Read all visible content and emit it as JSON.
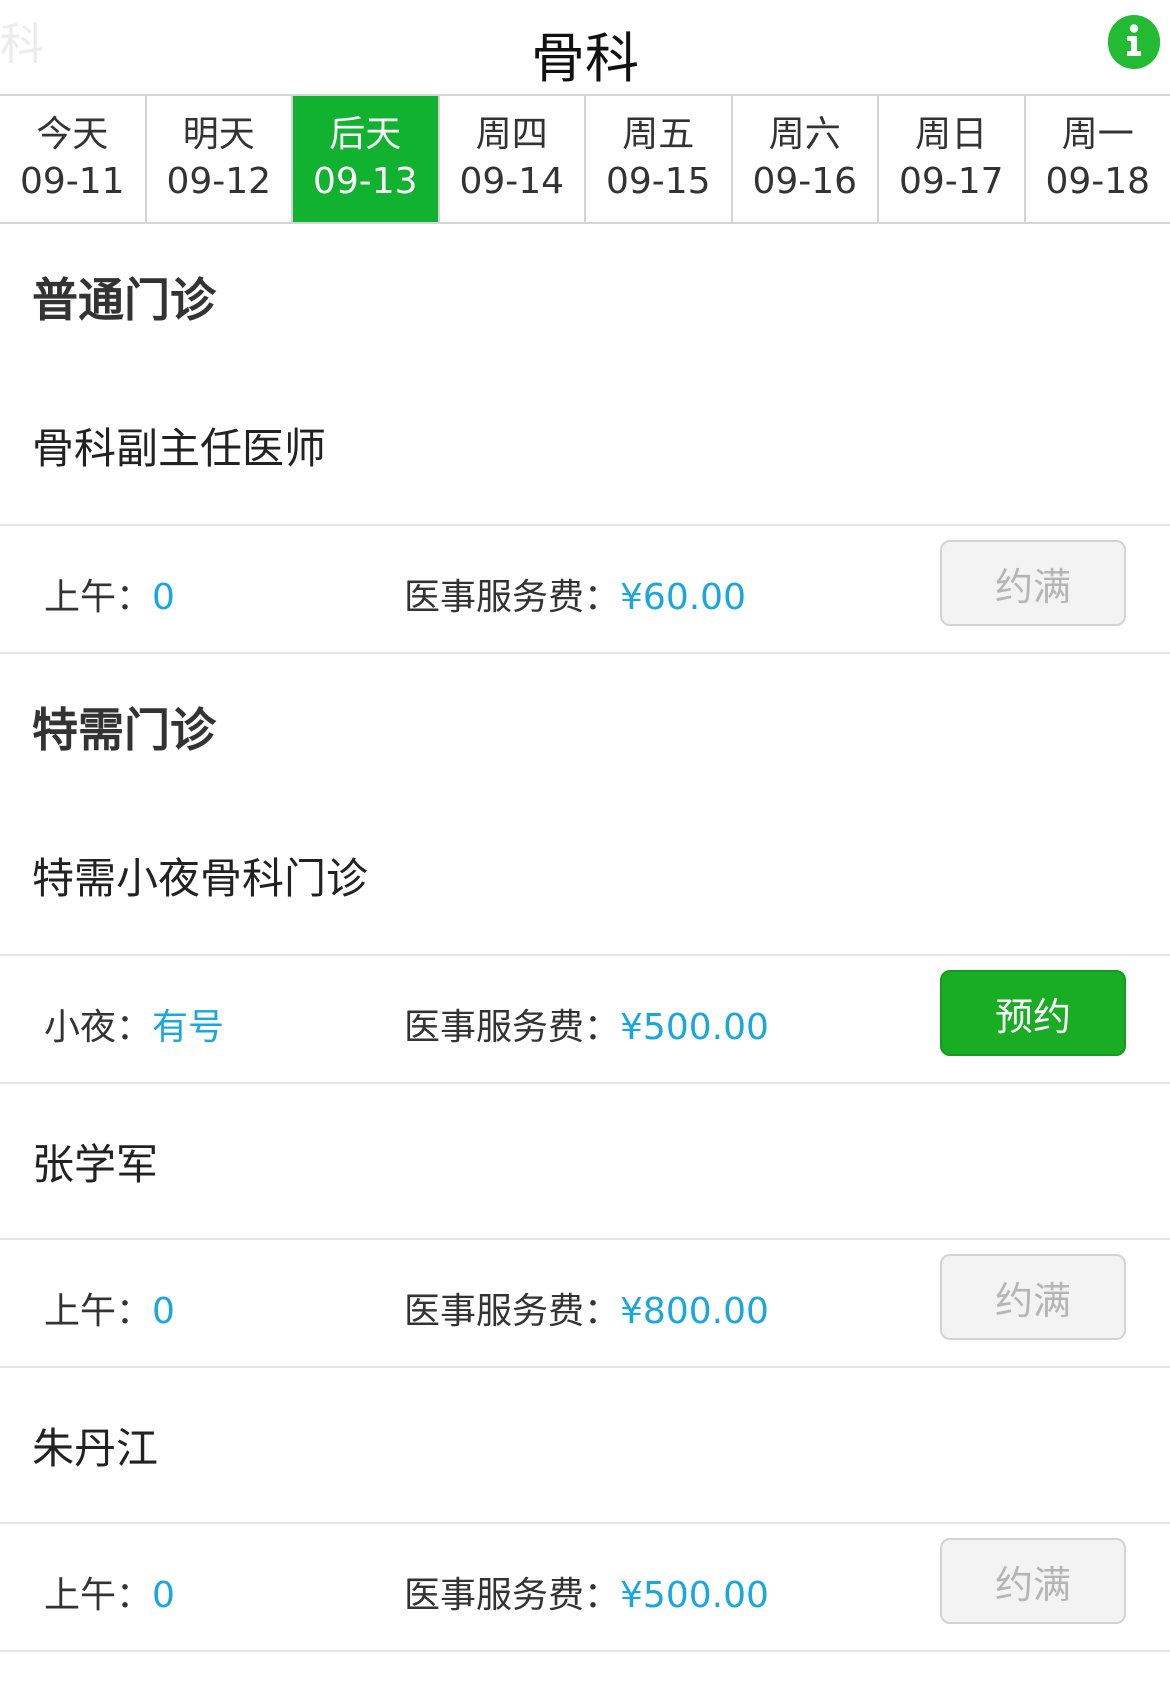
{
  "header": {
    "ghost_text": "科",
    "title": "骨科",
    "info_icon": "info-circle-icon",
    "accent_color": "#22bb33"
  },
  "date_tabs": [
    {
      "day": "今天",
      "date": "09-11",
      "selected": false
    },
    {
      "day": "明天",
      "date": "09-12",
      "selected": false
    },
    {
      "day": "后天",
      "date": "09-13",
      "selected": true
    },
    {
      "day": "周四",
      "date": "09-14",
      "selected": false
    },
    {
      "day": "周五",
      "date": "09-15",
      "selected": false
    },
    {
      "day": "周六",
      "date": "09-16",
      "selected": false
    },
    {
      "day": "周日",
      "date": "09-17",
      "selected": false
    },
    {
      "day": "周一",
      "date": "09-18",
      "selected": false
    }
  ],
  "sections": [
    {
      "title": "普通门诊",
      "doctors": [
        {
          "name": "骨科副主任医师",
          "slot_label": "上午：",
          "slot_value": "0",
          "fee_label": "医事服务费：",
          "fee_value": "¥60.00",
          "button": "约满",
          "status": "full"
        }
      ]
    },
    {
      "title": "特需门诊",
      "doctors": [
        {
          "name": "特需小夜骨科门诊",
          "slot_label": "小夜：",
          "slot_value": "有号",
          "fee_label": "医事服务费：",
          "fee_value": "¥500.00",
          "button": "预约",
          "status": "open"
        },
        {
          "name": "张学军",
          "slot_label": "上午：",
          "slot_value": "0",
          "fee_label": "医事服务费：",
          "fee_value": "¥800.00",
          "button": "约满",
          "status": "full"
        },
        {
          "name": "朱丹江",
          "slot_label": "上午：",
          "slot_value": "0",
          "fee_label": "医事服务费：",
          "fee_value": "¥500.00",
          "button": "约满",
          "status": "full"
        }
      ]
    }
  ],
  "colors": {
    "selected_tab": "#11b22f",
    "book_button": "#19ad24",
    "value_text": "#1aa7e0",
    "full_button_text": "#b5b5b5"
  }
}
